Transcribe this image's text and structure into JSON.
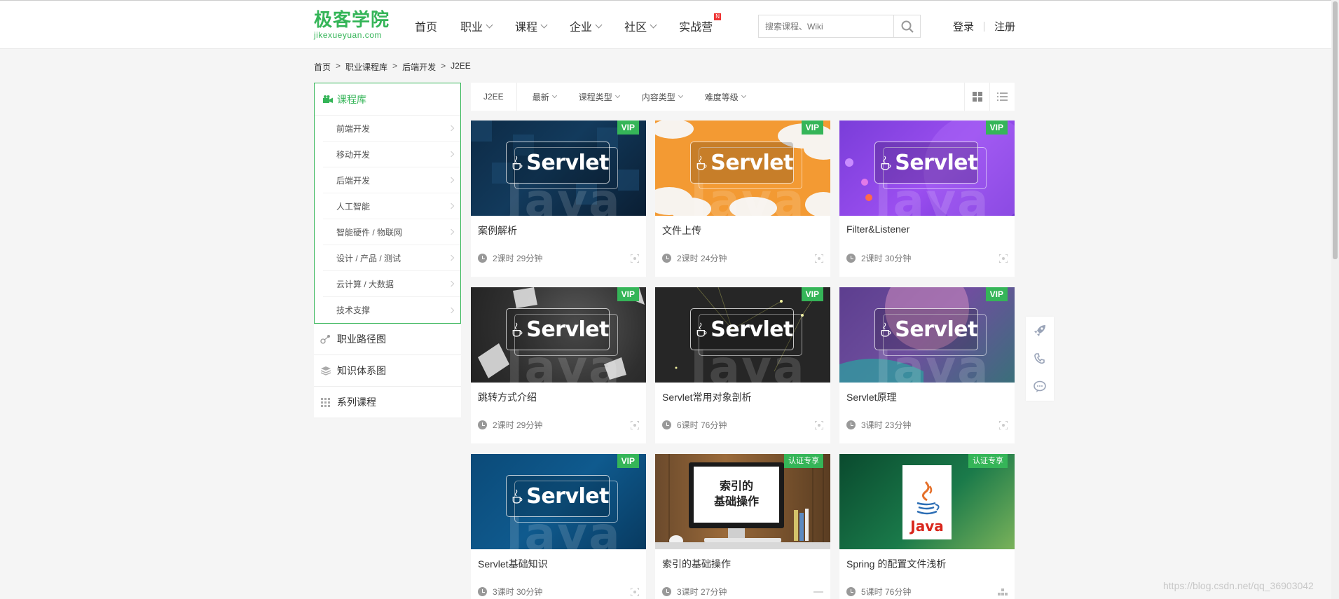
{
  "header": {
    "logo_cn": "极客学院",
    "logo_en": "jikexueyuan.com",
    "nav": [
      {
        "label": "首页",
        "has_dropdown": false
      },
      {
        "label": "职业",
        "has_dropdown": true
      },
      {
        "label": "课程",
        "has_dropdown": true
      },
      {
        "label": "企业",
        "has_dropdown": true
      },
      {
        "label": "社区",
        "has_dropdown": true
      },
      {
        "label": "实战营",
        "has_dropdown": false,
        "badge": "N"
      }
    ],
    "search_placeholder": "搜索课程、Wiki",
    "login": "登录",
    "register": "注册"
  },
  "breadcrumb": [
    "首页",
    "职业课程库",
    "后端开发",
    "J2EE"
  ],
  "sidebar": {
    "title": "课程库",
    "items": [
      "前端开发",
      "移动开发",
      "后端开发",
      "人工智能",
      "智能硬件 / 物联网",
      "设计 / 产品 / 测试",
      "云计算 / 大数据",
      "技术支撑"
    ],
    "links": [
      "职业路径图",
      "知识体系图",
      "系列课程"
    ]
  },
  "filters": {
    "tag": "J2EE",
    "items": [
      "最新",
      "课程类型",
      "内容类型",
      "难度等级"
    ]
  },
  "cards": [
    {
      "title": "案例解析",
      "meta": "2课时 29分钟",
      "badge": "VIP"
    },
    {
      "title": "文件上传",
      "meta": "2课时 24分钟",
      "badge": "VIP"
    },
    {
      "title": "Filter&Listener",
      "meta": "2课时 30分钟",
      "badge": "VIP"
    },
    {
      "title": "跳转方式介绍",
      "meta": "2课时 29分钟",
      "badge": "VIP"
    },
    {
      "title": "Servlet常用对象剖析",
      "meta": "6课时 76分钟",
      "badge": "VIP"
    },
    {
      "title": "Servlet原理",
      "meta": "3课时 23分钟",
      "badge": "VIP"
    },
    {
      "title": "Servlet基础知识",
      "meta": "3课时 30分钟",
      "badge": "VIP"
    },
    {
      "title": "索引的基础操作",
      "meta": "3课时 27分钟",
      "badge": "认证专享"
    },
    {
      "title": "Spring 的配置文件浅析",
      "meta": "5课时 76分钟",
      "badge": "认证专享"
    }
  ],
  "thumb_text": {
    "servlet": "Servlet",
    "java": "Java",
    "index_line1": "索引的",
    "index_line2": "基础操作"
  },
  "watermark": "https://blog.csdn.net/qq_36903042",
  "colors": {
    "accent": "#35b558"
  }
}
